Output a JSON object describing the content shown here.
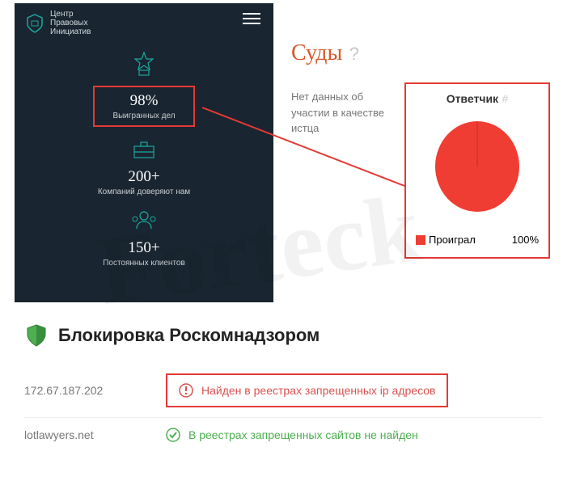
{
  "watermark": "Forteck",
  "dark_panel": {
    "brand_line1": "Центр",
    "brand_line2": "Правовых",
    "brand_line3": "Инициатив",
    "stats": [
      {
        "value": "98%",
        "label": "Выигранных дел",
        "highlighted": true
      },
      {
        "value": "200+",
        "label": "Компаний доверяют нам",
        "highlighted": false
      },
      {
        "value": "150+",
        "label": "Постоянных клиентов",
        "highlighted": false
      }
    ]
  },
  "courts": {
    "title": "Суды",
    "plaintiff_note": "Нет данных об участии в качестве истца",
    "defendant": {
      "title": "Ответчик",
      "legend_label": "Проиграл",
      "legend_value": "100%"
    }
  },
  "chart_data": {
    "type": "pie",
    "title": "Ответчик",
    "series": [
      {
        "name": "Проиграл",
        "value": 100,
        "color": "#f03d33"
      }
    ]
  },
  "block": {
    "title": "Блокировка Роскомнадзором",
    "rows": [
      {
        "key": "172.67.187.202",
        "status": "warn",
        "text": "Найден в реестрах запрещенных ip адресов"
      },
      {
        "key": "lotlawyers.net",
        "status": "ok",
        "text": "В реестрах запрещенных сайтов не найден"
      }
    ]
  }
}
